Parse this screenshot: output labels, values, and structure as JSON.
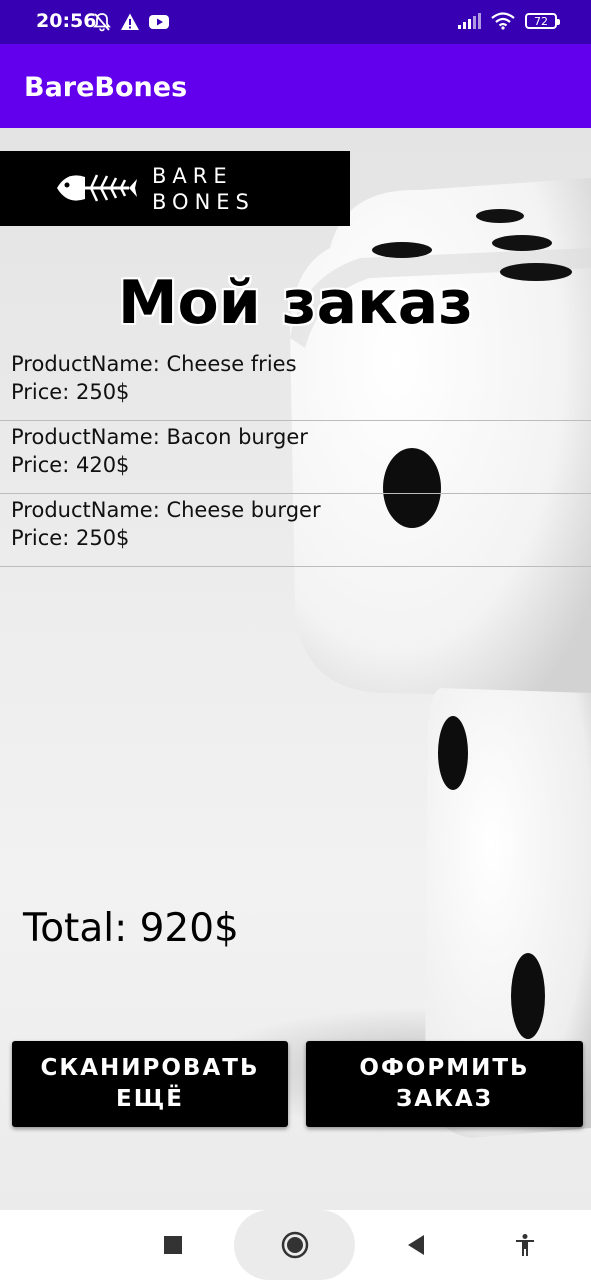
{
  "status_bar": {
    "time": "20:56",
    "left_icons": [
      "notifications-off-icon",
      "warning-icon",
      "youtube-icon"
    ],
    "right_icons": [
      "signal-icon",
      "wifi-icon",
      "battery-icon"
    ],
    "battery_level": "72"
  },
  "app_bar": {
    "title": "BareBones"
  },
  "logo": {
    "line1": "BARE",
    "line2": "BONES",
    "icon": "fish-bone-icon"
  },
  "page": {
    "title": "Мой заказ"
  },
  "order": {
    "items": [
      {
        "name": "ProductName: Cheese fries",
        "price": "Price: 250$"
      },
      {
        "name": "ProductName: Bacon burger",
        "price": "Price: 420$"
      },
      {
        "name": "ProductName: Cheese burger",
        "price": "Price: 250$"
      }
    ],
    "total": "Total: 920$"
  },
  "buttons": {
    "scan_more": "СКАНИРОВАТЬ\nЕЩЁ",
    "checkout": "ОФОРМИТЬ\nЗАКАЗ"
  },
  "nav_bar": {
    "icons": [
      "recents-square-icon",
      "home-circle-icon",
      "back-triangle-icon",
      "accessibility-icon"
    ]
  },
  "colors": {
    "status_bar": "#3700b3",
    "app_bar": "#6200ee",
    "button_bg": "#000000",
    "button_text": "#ffffff"
  }
}
